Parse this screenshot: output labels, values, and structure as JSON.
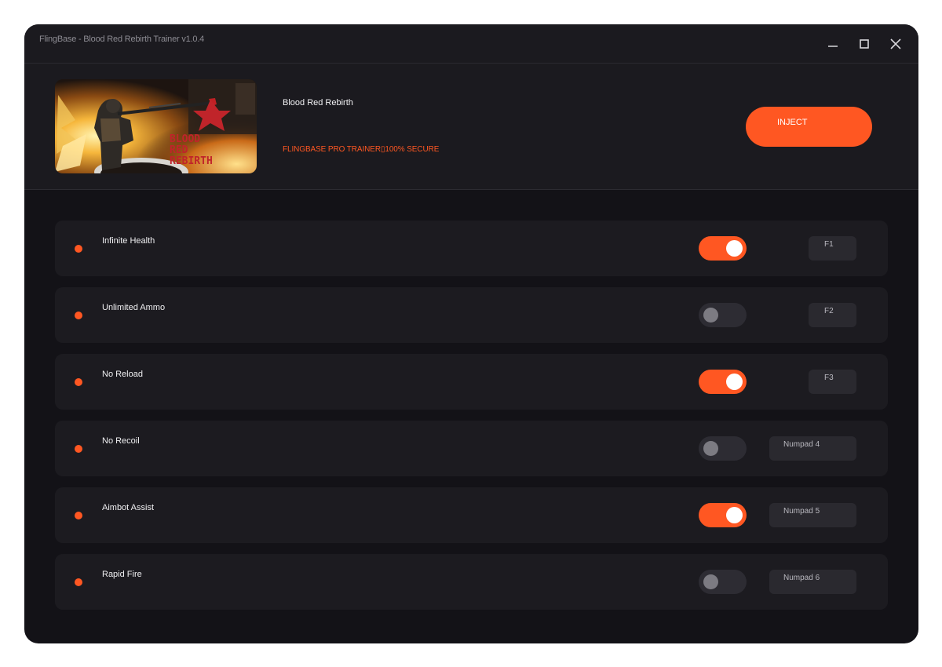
{
  "window": {
    "title": "FlingBase - Blood Red Rebirth Trainer v1.0.4"
  },
  "header": {
    "game_title": "Blood Red Rebirth",
    "subtitle": "FLINGBASE PRO TRAINER▯100% SECURE",
    "inject_label": "INJECT",
    "banner_text": [
      "BLOOD",
      "RED",
      "REBIRTH"
    ]
  },
  "colors": {
    "accent": "#ff5722",
    "window_bg": "#131217",
    "panel_bg": "#1b1a1f",
    "row_bg": "#1c1b20",
    "toggle_off": "#2d2c33"
  },
  "icons": {
    "minimize": "minimize-icon",
    "maximize": "maximize-icon",
    "close": "close-icon"
  },
  "cheats": [
    {
      "name": "Infinite Health",
      "enabled": true,
      "hotkey": "F1"
    },
    {
      "name": "Unlimited Ammo",
      "enabled": false,
      "hotkey": "F2"
    },
    {
      "name": "No Reload",
      "enabled": true,
      "hotkey": "F3"
    },
    {
      "name": "No Recoil",
      "enabled": false,
      "hotkey": "Numpad 4"
    },
    {
      "name": "Aimbot Assist",
      "enabled": true,
      "hotkey": "Numpad 5"
    },
    {
      "name": "Rapid Fire",
      "enabled": false,
      "hotkey": "Numpad 6"
    }
  ]
}
